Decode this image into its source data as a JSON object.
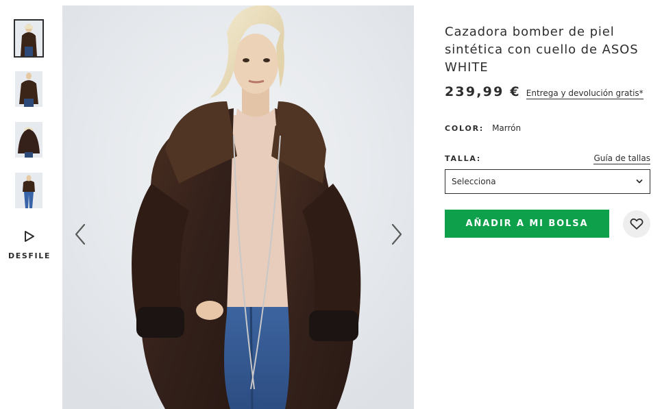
{
  "product": {
    "title": "Cazadora bomber de piel sintética con cuello de ASOS WHITE",
    "price": "239,99 €",
    "delivery_link": "Entrega y devolución gratis*",
    "color_label": "COLOR:",
    "color_value": "Marrón",
    "size_label": "TALLA:",
    "size_guide": "Guía de tallas",
    "size_select_value": "Selecciona",
    "add_to_bag": "AÑADIR A MI BOLSA"
  },
  "gallery": {
    "thumbnail_count": 4,
    "active_thumbnail": 1,
    "runway_label": "DESFILE"
  },
  "icons": {
    "runway": "play-icon",
    "prev": "chevron-left-icon",
    "next": "chevron-right-icon",
    "dropdown": "chevron-down-icon",
    "save": "heart-icon"
  },
  "colors": {
    "accent_green": "#0fa04c",
    "text": "#2d2d2d",
    "coat_brown": "#3b2519",
    "backdrop": "#e6e9ed"
  }
}
